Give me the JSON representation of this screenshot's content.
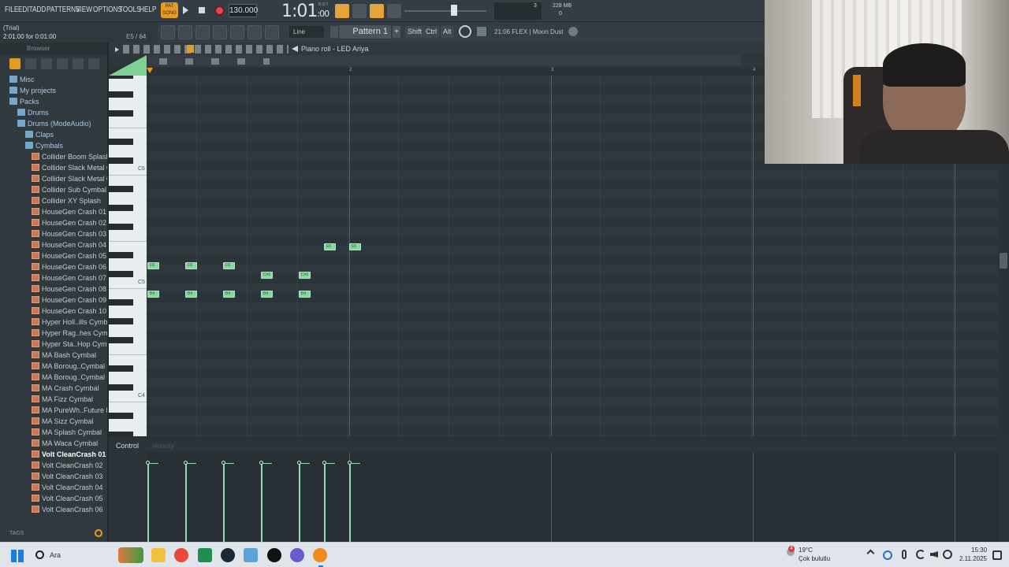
{
  "menu": [
    "FILE",
    "EDIT",
    "ADD",
    "PATTERNS",
    "VIEW",
    "OPTIONS",
    "TOOLS",
    "HELP"
  ],
  "transport": {
    "pat_label": "PAT",
    "song_label": "SONG",
    "tempo": "130.000",
    "time_main": "1:01",
    "time_sub": ":00",
    "time_top": "B:S:T",
    "memory": "228 MB",
    "cpu_val": "3",
    "poly_val": "0"
  },
  "hint": {
    "line1": "(Trial)",
    "line2": "2:01:00 for 0:01:00",
    "position": "E5 / 64"
  },
  "toolbar2": {
    "snap": "Line",
    "pattern": "Pattern 1",
    "shift": "Shift",
    "ctrl": "Ctrl",
    "alt": "Alt",
    "flex_info": "21:06  FLEX | Moon Dust"
  },
  "browser": {
    "header": "Browser",
    "tags": "TAGS",
    "items": [
      {
        "label": "Misc",
        "type": "folder",
        "indent": 0
      },
      {
        "label": "My projects",
        "type": "folder",
        "indent": 0
      },
      {
        "label": "Packs",
        "type": "folder",
        "indent": 0
      },
      {
        "label": "Drums",
        "type": "folder",
        "indent": 1
      },
      {
        "label": "Drums (ModeAudio)",
        "type": "folder",
        "indent": 1
      },
      {
        "label": "Claps",
        "type": "folder",
        "indent": 2
      },
      {
        "label": "Cymbals",
        "type": "folder",
        "indent": 2
      },
      {
        "label": "Collider Boom Splash",
        "type": "sample",
        "indent": 3
      },
      {
        "label": "Collider Slack Metal 01",
        "type": "sample",
        "indent": 3
      },
      {
        "label": "Collider Slack Metal 02",
        "type": "sample",
        "indent": 3
      },
      {
        "label": "Collider Sub Cymbal",
        "type": "sample",
        "indent": 3
      },
      {
        "label": "Collider XY Splash",
        "type": "sample",
        "indent": 3
      },
      {
        "label": "HouseGen Crash 01",
        "type": "sample",
        "indent": 3
      },
      {
        "label": "HouseGen Crash 02",
        "type": "sample",
        "indent": 3
      },
      {
        "label": "HouseGen Crash 03",
        "type": "sample",
        "indent": 3
      },
      {
        "label": "HouseGen Crash 04",
        "type": "sample",
        "indent": 3
      },
      {
        "label": "HouseGen Crash 05",
        "type": "sample",
        "indent": 3
      },
      {
        "label": "HouseGen Crash 06",
        "type": "sample",
        "indent": 3
      },
      {
        "label": "HouseGen Crash 07",
        "type": "sample",
        "indent": 3
      },
      {
        "label": "HouseGen Crash 08",
        "type": "sample",
        "indent": 3
      },
      {
        "label": "HouseGen Crash 09",
        "type": "sample",
        "indent": 3
      },
      {
        "label": "HouseGen Crash 10",
        "type": "sample",
        "indent": 3
      },
      {
        "label": "Hyper Holl..ills Cymbal",
        "type": "sample",
        "indent": 3
      },
      {
        "label": "Hyper Rag..hes Cymbal",
        "type": "sample",
        "indent": 3
      },
      {
        "label": "Hyper Sta..Hop Cymbal",
        "type": "sample",
        "indent": 3
      },
      {
        "label": "MA Bash Cymbal",
        "type": "sample",
        "indent": 3
      },
      {
        "label": "MA Boroug..Cymbal 01",
        "type": "sample",
        "indent": 3
      },
      {
        "label": "MA Boroug..Cymbal 02",
        "type": "sample",
        "indent": 3
      },
      {
        "label": "MA Crash Cymbal",
        "type": "sample",
        "indent": 3
      },
      {
        "label": "MA Fizz Cymbal",
        "type": "sample",
        "indent": 3
      },
      {
        "label": "MA PureWh..Future FX",
        "type": "sample",
        "indent": 3
      },
      {
        "label": "MA Sizz Cymbal",
        "type": "sample",
        "indent": 3
      },
      {
        "label": "MA Splash Cymbal",
        "type": "sample",
        "indent": 3
      },
      {
        "label": "MA Waca Cymbal",
        "type": "sample",
        "indent": 3
      },
      {
        "label": "Volt CleanCrash 01",
        "type": "sample",
        "indent": 3,
        "selected": true
      },
      {
        "label": "Volt CleanCrash 02",
        "type": "sample",
        "indent": 3
      },
      {
        "label": "Volt CleanCrash 03",
        "type": "sample",
        "indent": 3
      },
      {
        "label": "Volt CleanCrash 04",
        "type": "sample",
        "indent": 3
      },
      {
        "label": "Volt CleanCrash 05",
        "type": "sample",
        "indent": 3
      },
      {
        "label": "Volt CleanCrash 06",
        "type": "sample",
        "indent": 3
      }
    ]
  },
  "piano_roll": {
    "title": "Piano roll - LED Ariya",
    "bar_numbers": [
      "2",
      "3",
      "4"
    ],
    "key_labels": [
      "C6",
      "C5",
      "C4"
    ],
    "notes": [
      {
        "label": "D5",
        "step": 0,
        "pitch": "D5"
      },
      {
        "label": "B4",
        "step": 0,
        "pitch": "B4"
      },
      {
        "label": "D5",
        "step": 3,
        "pitch": "D5"
      },
      {
        "label": "B4",
        "step": 3,
        "pitch": "B4"
      },
      {
        "label": "D5",
        "step": 6,
        "pitch": "D5"
      },
      {
        "label": "B4",
        "step": 6,
        "pitch": "B4"
      },
      {
        "label": "C#5",
        "step": 9,
        "pitch": "C#5"
      },
      {
        "label": "B4",
        "step": 9,
        "pitch": "B4"
      },
      {
        "label": "C#5",
        "step": 12,
        "pitch": "C#5"
      },
      {
        "label": "B4",
        "step": 12,
        "pitch": "B4"
      },
      {
        "label": "E5",
        "step": 14,
        "pitch": "E5"
      },
      {
        "label": "E5",
        "step": 16,
        "pitch": "E5"
      }
    ]
  },
  "control": {
    "label": "Control",
    "sublabel": "Velocity"
  },
  "taskbar": {
    "search": "Ara",
    "weather_temp": "19°C",
    "weather_desc": "Çok bulutlu",
    "time": "15:30",
    "date": "2.11.2025",
    "badge": "4"
  }
}
